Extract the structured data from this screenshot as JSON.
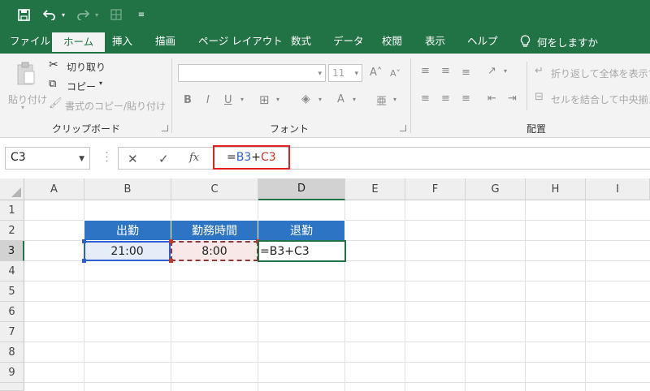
{
  "ribbon": {
    "tabs": [
      {
        "id": "file",
        "label": "ファイル"
      },
      {
        "id": "home",
        "label": "ホーム"
      },
      {
        "id": "insert",
        "label": "挿入"
      },
      {
        "id": "draw",
        "label": "描画"
      },
      {
        "id": "page-layout",
        "label": "ページ レイアウト"
      },
      {
        "id": "formulas",
        "label": "数式"
      },
      {
        "id": "data",
        "label": "データ"
      },
      {
        "id": "review",
        "label": "校閲"
      },
      {
        "id": "view",
        "label": "表示"
      },
      {
        "id": "help",
        "label": "ヘルプ"
      }
    ],
    "active_tab": "ホーム",
    "tell_me": "何をしますか",
    "clipboard": {
      "paste": "貼り付け",
      "cut": "切り取り",
      "copy": "コピー",
      "format_painter": "書式のコピー/貼り付け",
      "label": "クリップボード"
    },
    "font": {
      "size": "11",
      "bold": "B",
      "italic": "I",
      "underline": "U",
      "label": "フォント"
    },
    "alignment": {
      "wrap_text": "折り返して全体を表示す",
      "merge_center": "セルを結合して中央揃え",
      "label": "配置"
    }
  },
  "formula_bar": {
    "name_box": "C3",
    "fx": "fx",
    "formula_prefix": "=",
    "ref1": "B3",
    "plus": "+",
    "ref2": "C3"
  },
  "sheet": {
    "columns": [
      "A",
      "B",
      "C",
      "D",
      "E",
      "F",
      "G",
      "H",
      "I"
    ],
    "rows": [
      "1",
      "2",
      "3",
      "4",
      "5",
      "6",
      "7",
      "8",
      "9"
    ],
    "selected_column": "D",
    "selected_row": "3",
    "table_headers": [
      "出勤",
      "勤務時間",
      "退勤"
    ],
    "row3": {
      "B": "21:00",
      "C": "8:00",
      "D": "=B3+C3"
    }
  },
  "colors": {
    "excel_green": "#217346",
    "header_blue": "#2e74c4",
    "ref_blue": "#2e5fd0",
    "ref_red": "#c0392b",
    "b3_fill": "#e6edf8",
    "c3_fill": "#f9e8e8",
    "highlight_red": "#e02020"
  }
}
